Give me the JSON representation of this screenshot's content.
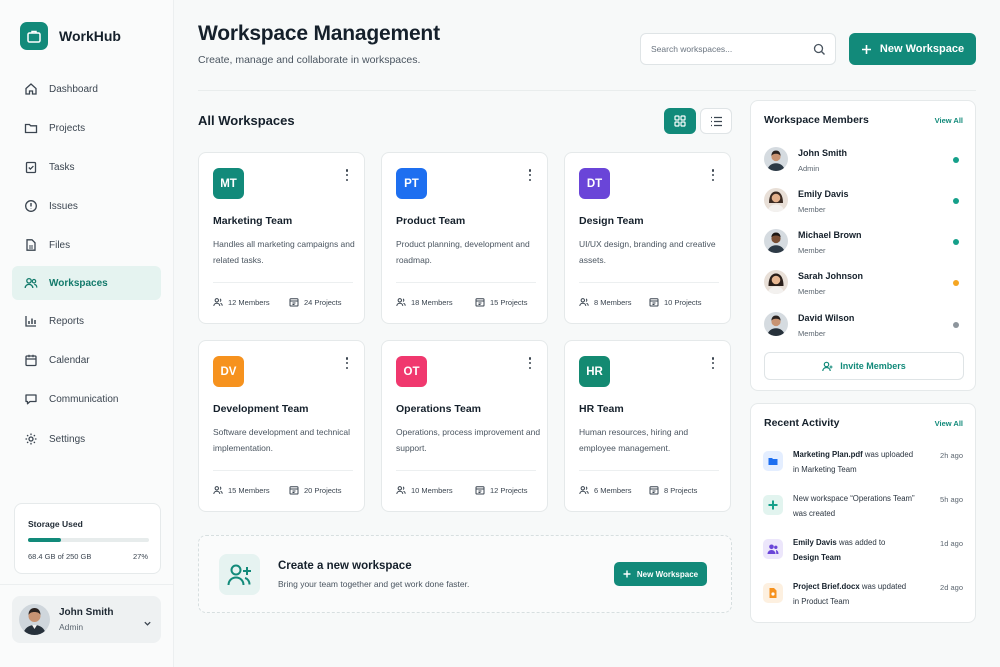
{
  "app": {
    "name": "WorkHub"
  },
  "sidebar": {
    "items": [
      {
        "label": "Dashboard",
        "icon": "home-icon"
      },
      {
        "label": "Projects",
        "icon": "folder-icon"
      },
      {
        "label": "Tasks",
        "icon": "clipboard-check-icon"
      },
      {
        "label": "Issues",
        "icon": "alert-circle-icon"
      },
      {
        "label": "Files",
        "icon": "file-icon"
      },
      {
        "label": "Workspaces",
        "icon": "users-icon",
        "active": true
      },
      {
        "label": "Reports",
        "icon": "bar-chart-icon"
      },
      {
        "label": "Calendar",
        "icon": "calendar-icon"
      },
      {
        "label": "Communication",
        "icon": "chat-icon"
      },
      {
        "label": "Settings",
        "icon": "gear-icon"
      }
    ],
    "storage": {
      "title": "Storage Used",
      "used_text": "68.4 GB of 250 GB",
      "percent_text": "27%",
      "fraction": 0.27
    },
    "user": {
      "name": "John Smith",
      "role": "Admin"
    }
  },
  "header": {
    "title": "Workspace Management",
    "subtitle": "Create, manage and collaborate in workspaces.",
    "search_placeholder": "Search workspaces...",
    "new_button": "New Workspace"
  },
  "main": {
    "section_title": "All Workspaces",
    "workspaces": [
      {
        "initials": "MT",
        "color": "#128a7a",
        "name": "Marketing Team",
        "desc": "Handles all marketing campaigns and related tasks.",
        "members": "12 Members",
        "projects": "24 Projects"
      },
      {
        "initials": "PT",
        "color": "#1e6ff0",
        "name": "Product Team",
        "desc": "Product planning, development and roadmap.",
        "members": "18 Members",
        "projects": "15 Projects"
      },
      {
        "initials": "DT",
        "color": "#6a45d8",
        "name": "Design Team",
        "desc": "UI/UX design, branding and creative assets.",
        "members": "8 Members",
        "projects": "10 Projects"
      },
      {
        "initials": "DV",
        "color": "#f6921e",
        "name": "Development Team",
        "desc": "Software development and technical implementation.",
        "members": "15 Members",
        "projects": "20 Projects"
      },
      {
        "initials": "OT",
        "color": "#f0386e",
        "name": "Operations Team",
        "desc": "Operations, process improvement and support.",
        "members": "10 Members",
        "projects": "12 Projects"
      },
      {
        "initials": "HR",
        "color": "#148a72",
        "name": "HR Team",
        "desc": "Human resources, hiring and employee management.",
        "members": "6 Members",
        "projects": "8 Projects"
      }
    ],
    "create_banner": {
      "title": "Create a new workspace",
      "subtitle": "Bring your team together and get work done faster.",
      "button": "New Workspace"
    }
  },
  "members_panel": {
    "title": "Workspace Members",
    "link": "View All",
    "members": [
      {
        "name": "John Smith",
        "role": "Admin",
        "status_color": "#15a08a"
      },
      {
        "name": "Emily Davis",
        "role": "Member",
        "status_color": "#15a08a"
      },
      {
        "name": "Michael Brown",
        "role": "Member",
        "status_color": "#15a08a"
      },
      {
        "name": "Sarah Johnson",
        "role": "Member",
        "status_color": "#f5a623"
      },
      {
        "name": "David Wilson",
        "role": "Member",
        "status_color": "#8d959c"
      }
    ],
    "invite_button": "Invite Members"
  },
  "activity_panel": {
    "title": "Recent Activity",
    "link": "View All",
    "items": [
      {
        "subject": "Marketing Plan.pdf",
        "action": " was uploaded",
        "line2": "in Marketing Team",
        "time": "2h ago",
        "icon": "file-upload-icon",
        "color": "#1e6ff0",
        "bg": "#e4eeff"
      },
      {
        "subject": "",
        "action": "New workspace “Operations Team”",
        "line2": "was created",
        "time": "5h ago",
        "icon": "plus-icon",
        "color": "#15a08a",
        "bg": "#e2f4ef"
      },
      {
        "subject": "Emily Davis",
        "action": " was added to",
        "line2": "Design Team",
        "time": "1d ago",
        "icon": "user-add-icon",
        "color": "#6a45d8",
        "bg": "#ece6fb"
      },
      {
        "subject": "Project Brief.docx",
        "action": " was updated",
        "line2": "in Product Team",
        "time": "2d ago",
        "icon": "document-icon",
        "color": "#f6921e",
        "bg": "#fdf0e0"
      }
    ]
  }
}
